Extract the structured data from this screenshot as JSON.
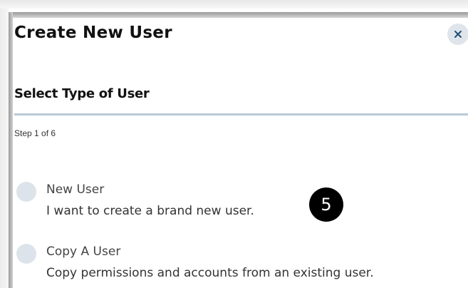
{
  "dialog": {
    "title": "Create New User",
    "close_icon": "close-icon",
    "section_title": "Select Type of User",
    "step_text": "Step 1 of 6",
    "options": [
      {
        "label": "New User",
        "description": "I want to create a brand new user.",
        "selected": false
      },
      {
        "label": "Copy A User",
        "description": "Copy permissions and accounts from an existing user.",
        "selected": false
      }
    ]
  },
  "annotation": {
    "step_marker": "5"
  },
  "colors": {
    "divider": "#b7c9d6",
    "radio": "#dde3ea",
    "close_button_bg": "#dfe5ea",
    "close_icon": "#1f4f7a",
    "marker_bg": "#000000"
  }
}
